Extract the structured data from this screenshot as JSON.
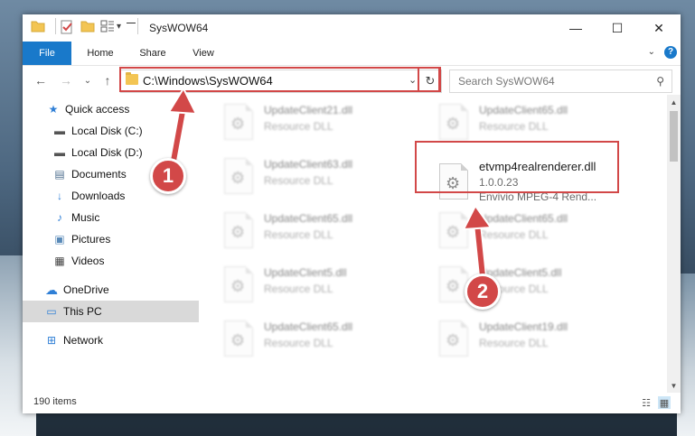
{
  "window": {
    "title": "SysWOW64",
    "minimize_glyph": "—",
    "maximize_glyph": "☐",
    "close_glyph": "✕"
  },
  "quick_access_toolbar": {
    "icons": [
      "folder-icon",
      "properties-icon",
      "new-folder-icon",
      "customize-icon"
    ],
    "dropdown_glyph": "▾"
  },
  "ribbon": {
    "tabs": [
      {
        "label": "File"
      },
      {
        "label": "Home"
      },
      {
        "label": "Share"
      },
      {
        "label": "View"
      }
    ],
    "help_glyph": "?",
    "collapse_glyph": "⌄"
  },
  "navigation": {
    "back_glyph": "←",
    "forward_glyph": "→",
    "recent_glyph": "⌄",
    "up_glyph": "↑"
  },
  "address_bar": {
    "path": "C:\\Windows\\SysWOW64",
    "dropdown_glyph": "⌄",
    "refresh_glyph": "↻"
  },
  "search": {
    "placeholder": "Search SysWOW64",
    "icon_glyph": "⚲"
  },
  "sidebar": {
    "items": [
      {
        "label": "Quick access",
        "icon": "star-icon",
        "glyph": "★",
        "color": "#2f7fd6",
        "pinned": false
      },
      {
        "label": "Local Disk (C:)",
        "icon": "drive-icon",
        "glyph": "▬",
        "color": "#555555",
        "pinned": true
      },
      {
        "label": "Local Disk (D:)",
        "icon": "drive-icon",
        "glyph": "▬",
        "color": "#555555",
        "pinned": true
      },
      {
        "label": "Documents",
        "icon": "documents-icon",
        "glyph": "▤",
        "color": "#4f6f8f",
        "pinned": true
      },
      {
        "label": "Downloads",
        "icon": "download-icon",
        "glyph": "↓",
        "color": "#2f7fd6",
        "pinned": true
      },
      {
        "label": "Music",
        "icon": "music-icon",
        "glyph": "♪",
        "color": "#2f7fd6",
        "pinned": true
      },
      {
        "label": "Pictures",
        "icon": "pictures-icon",
        "glyph": "▣",
        "color": "#5a8ab8",
        "pinned": true
      },
      {
        "label": "Videos",
        "icon": "videos-icon",
        "glyph": "▦",
        "color": "#444444",
        "pinned": true
      },
      {
        "label": "OneDrive",
        "icon": "cloud-icon",
        "glyph": "☁",
        "color": "#2f7fd6",
        "pinned": false
      },
      {
        "label": "This PC",
        "icon": "computer-icon",
        "glyph": "▭",
        "color": "#2f7fd6",
        "pinned": false
      },
      {
        "label": "Network",
        "icon": "network-icon",
        "glyph": "⊞",
        "color": "#2f7fd6",
        "pinned": false
      }
    ],
    "selected": "This PC",
    "pin_glyph": "📌"
  },
  "files": {
    "left_column": [
      {
        "name": "UpdateClient21.dll",
        "description": "Resource DLL"
      },
      {
        "name": "UpdateClient63.dll",
        "description": "Resource DLL"
      },
      {
        "name": "UpdateClient65.dll",
        "description": "Resource DLL"
      },
      {
        "name": "UpdateClient5.dll",
        "description": "Resource DLL"
      },
      {
        "name": "UpdateClient65.dll",
        "description": "Resource DLL"
      }
    ],
    "right_column": [
      {
        "name": "UpdateClient65.dll",
        "description": "Resource DLL"
      },
      {
        "name": "UpdateClient65.dll",
        "description": "Resource DLL"
      },
      {
        "name": "UpdateClient5.dll",
        "description": "Resource DLL"
      },
      {
        "name": "UpdateClient19.dll",
        "description": "Resource DLL"
      }
    ],
    "highlighted": {
      "name": "etvmp4realrenderer.dll",
      "version": "1.0.0.23",
      "description": "Envivio MPEG-4 Rend..."
    }
  },
  "status_bar": {
    "item_count": "190 items",
    "details_view_glyph": "☷",
    "tiles_view_glyph": "▦"
  },
  "annotations": {
    "step_1": "1",
    "step_2": "2",
    "highlight_color": "#d24848"
  }
}
